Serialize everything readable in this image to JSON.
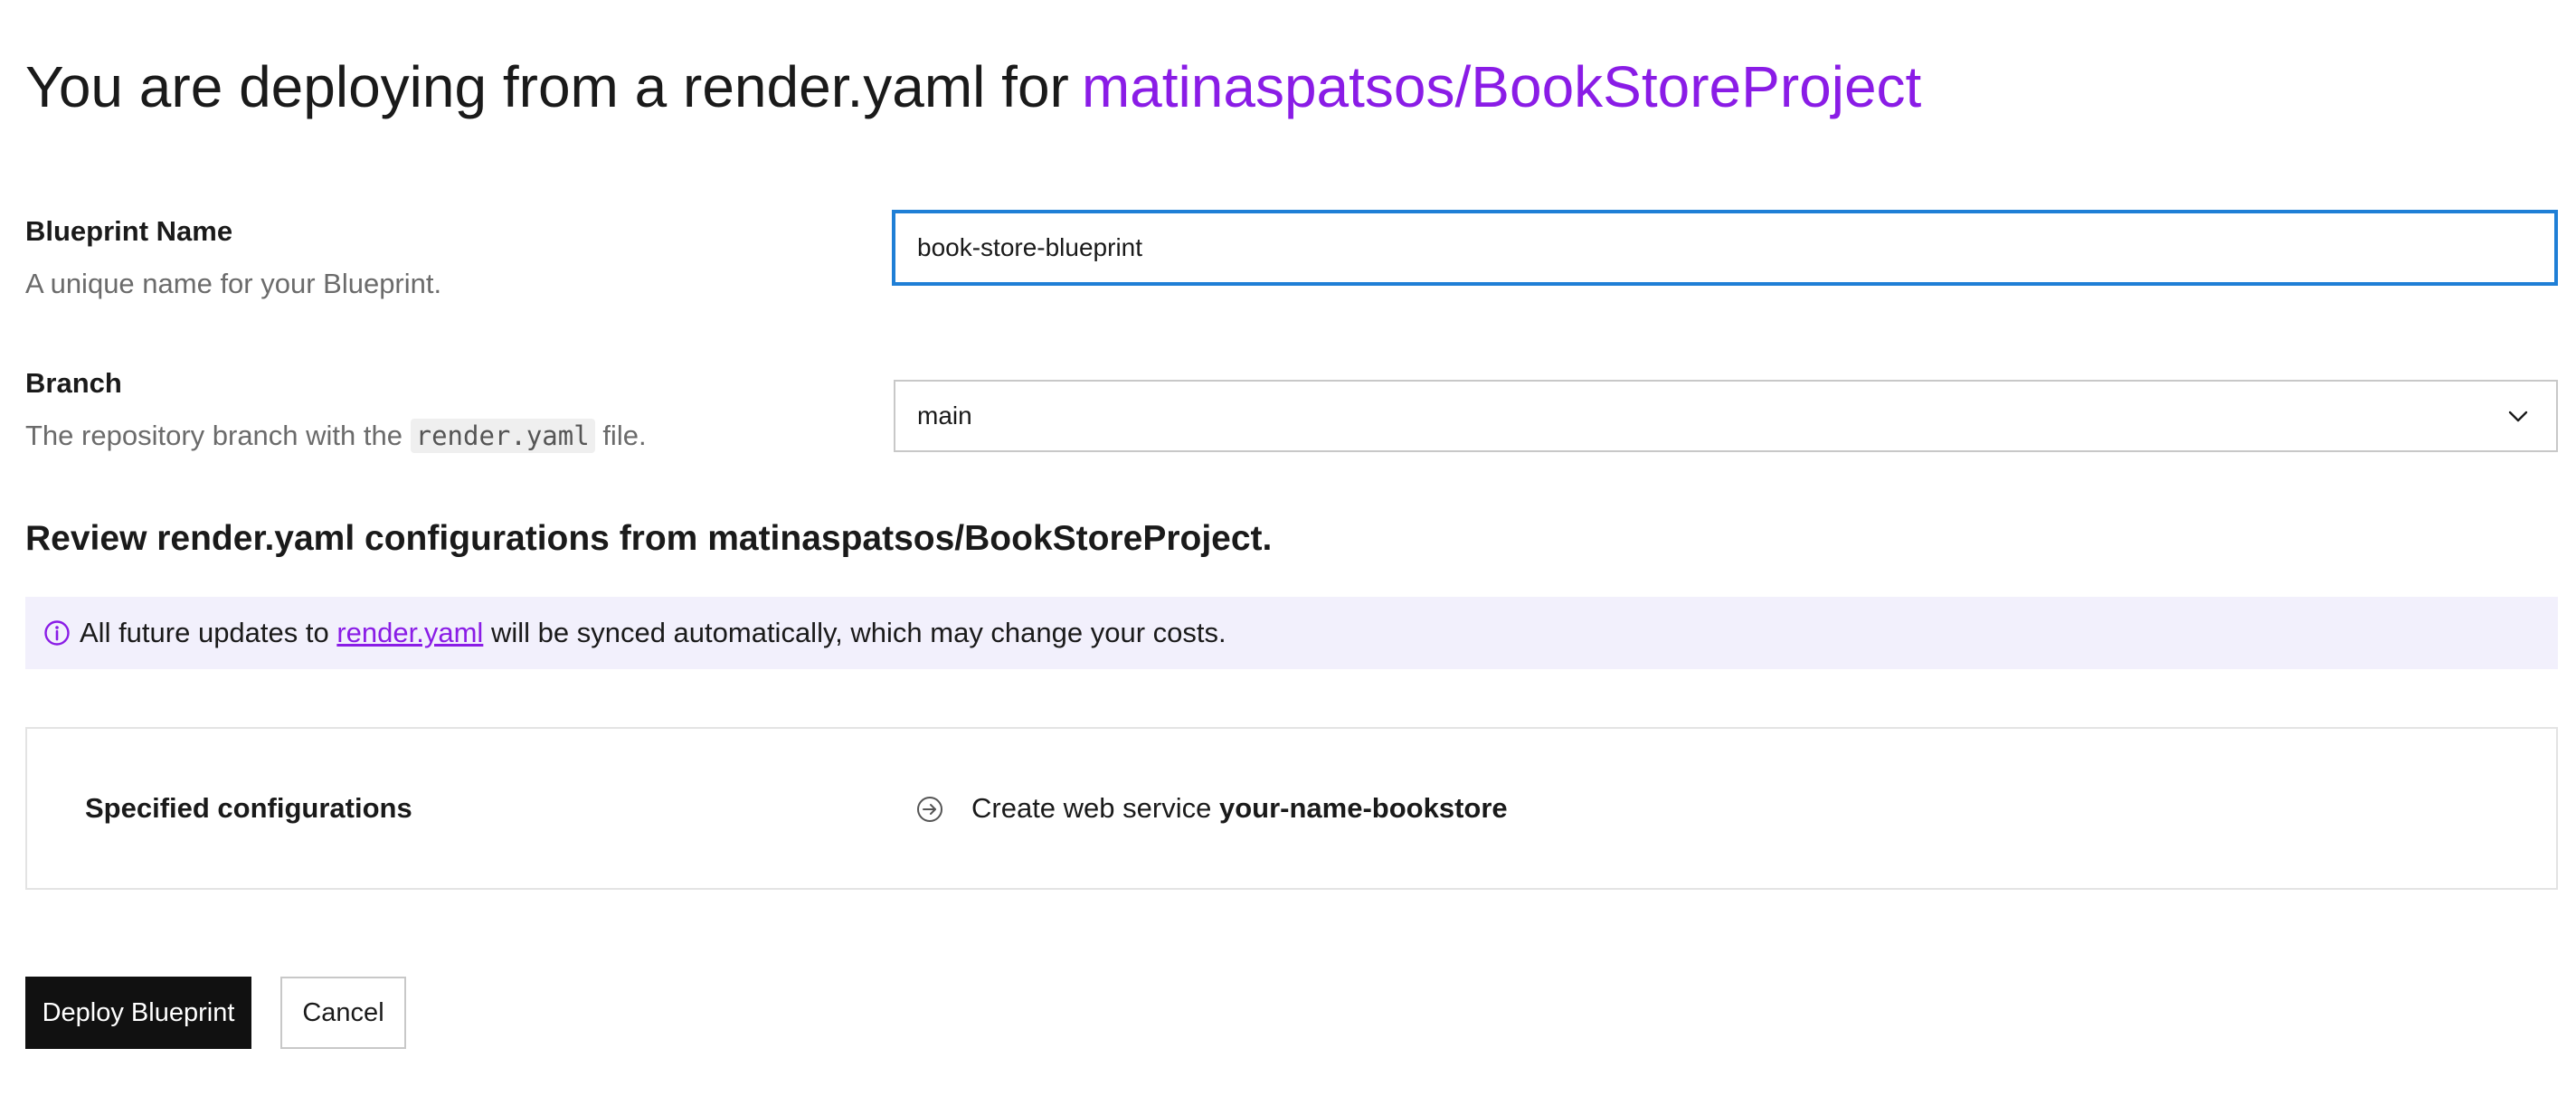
{
  "header": {
    "title_prefix": "You are deploying from a render.yaml for",
    "repo_name": "matinaspatsos/BookStoreProject"
  },
  "blueprint_name": {
    "label": "Blueprint Name",
    "help": "A unique name for your Blueprint.",
    "value": "book-store-blueprint"
  },
  "branch": {
    "label": "Branch",
    "help_prefix": "The repository branch with the",
    "help_code": "render.yaml",
    "help_suffix": "file.",
    "selected": "main"
  },
  "review": {
    "heading": "Review render.yaml configurations from matinaspatsos/BookStoreProject."
  },
  "info_banner": {
    "text_prefix": "All future updates to",
    "link_text": "render.yaml",
    "text_suffix": "will be synced automatically, which may change your costs.",
    "icon": "info-circle-icon"
  },
  "configurations": {
    "label": "Specified configurations",
    "item_prefix": "Create web service",
    "item_name": "your-name-bookstore",
    "icon": "arrow-right-circle-icon"
  },
  "actions": {
    "deploy_label": "Deploy Blueprint",
    "cancel_label": "Cancel"
  },
  "colors": {
    "accent": "#8a1ce6",
    "focus": "#1f7fd6",
    "banner_bg": "#f2f0fc",
    "primary_button": "#111111"
  }
}
